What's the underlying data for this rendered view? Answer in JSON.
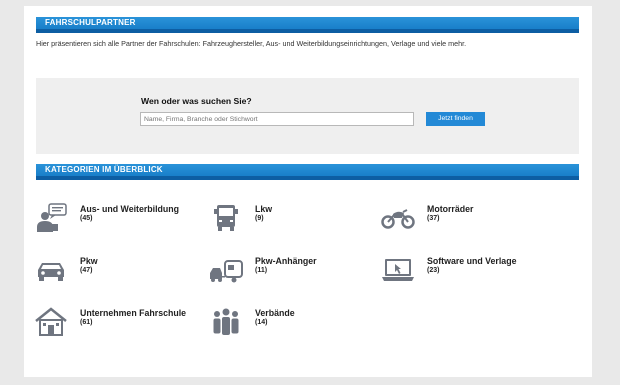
{
  "partners_section": {
    "heading": "FAHRSCHULPARTNER"
  },
  "intro_text": "Hier präsentieren sich alle Partner der Fahrschulen: Fahrzeughersteller, Aus- und Weiterbildungseinrichtungen, Verlage und viele mehr.",
  "search": {
    "title": "Wen oder was suchen Sie?",
    "placeholder": "Name, Firma, Branche oder Stichwort",
    "button_label": "Jetzt finden"
  },
  "categories_section": {
    "heading": "KATEGORIEN IM ÜBERBLICK"
  },
  "categories": [
    {
      "name": "Aus- und Weiterbildung",
      "count": "(45)",
      "icon": "teacher-speech-icon"
    },
    {
      "name": "Lkw",
      "count": "(9)",
      "icon": "truck-icon"
    },
    {
      "name": "Motorräder",
      "count": "(37)",
      "icon": "motorcycle-icon"
    },
    {
      "name": "Pkw",
      "count": "(47)",
      "icon": "car-icon"
    },
    {
      "name": "Pkw-Anhänger",
      "count": "(11)",
      "icon": "car-trailer-icon"
    },
    {
      "name": "Software und Verlage",
      "count": "(23)",
      "icon": "laptop-icon"
    },
    {
      "name": "Unternehmen Fahrschule",
      "count": "(61)",
      "icon": "school-building-icon"
    },
    {
      "name": "Verbände",
      "count": "(14)",
      "icon": "group-people-icon"
    }
  ],
  "colors": {
    "accent": "#1a82d0",
    "icon_gray": "#6f7580",
    "panel": "#efefef"
  }
}
